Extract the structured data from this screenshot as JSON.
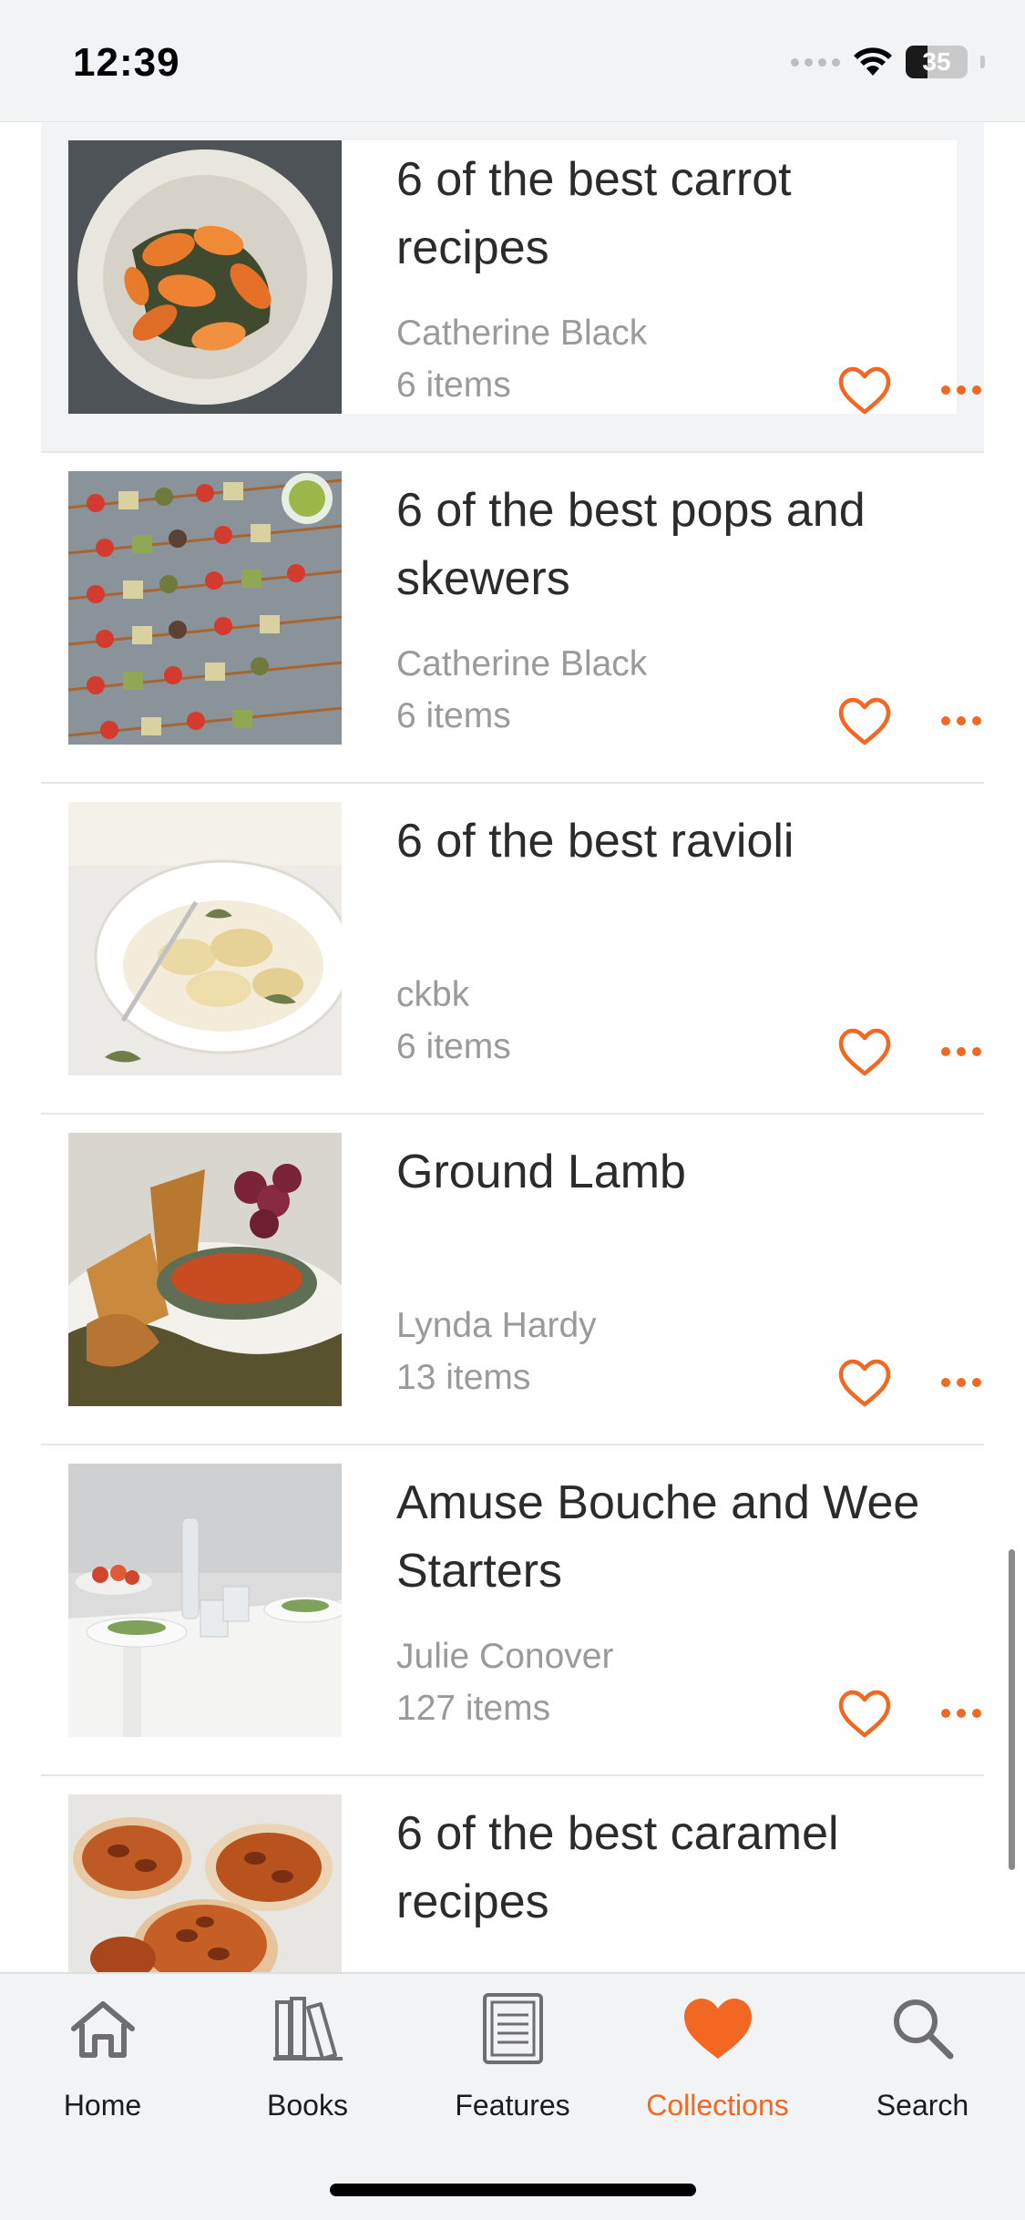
{
  "status_bar": {
    "time": "12:39",
    "battery": "35",
    "battery_level": 0.35
  },
  "accent_color": "#f26722",
  "collections": [
    {
      "title": "6 of the best carrot recipes",
      "author": "Catherine Black",
      "count": "6 items",
      "image": "roasted-carrots",
      "highlighted": true
    },
    {
      "title": "6 of the best pops and skewers",
      "author": "Catherine Black",
      "count": "6 items",
      "image": "vegetable-skewers",
      "highlighted": false
    },
    {
      "title": "6 of the best ravioli",
      "author": "ckbk",
      "count": "6 items",
      "image": "ravioli-bowl",
      "highlighted": false
    },
    {
      "title": "Ground Lamb",
      "author": "Lynda Hardy",
      "count": "13 items",
      "image": "lamb-pastries",
      "highlighted": false
    },
    {
      "title": "Amuse Bouche and Wee Starters",
      "author": "Julie Conover",
      "count": "127 items",
      "image": "starters-table",
      "highlighted": false
    },
    {
      "title": "6 of the best caramel recipes",
      "author": "",
      "count": "",
      "image": "caramel-pecan-buns",
      "highlighted": false
    }
  ],
  "tabs": [
    {
      "label": "Home",
      "icon": "home-icon",
      "active": false
    },
    {
      "label": "Books",
      "icon": "books-icon",
      "active": false
    },
    {
      "label": "Features",
      "icon": "features-icon",
      "active": false
    },
    {
      "label": "Collections",
      "icon": "heart-icon",
      "active": true
    },
    {
      "label": "Search",
      "icon": "search-icon",
      "active": false
    }
  ]
}
